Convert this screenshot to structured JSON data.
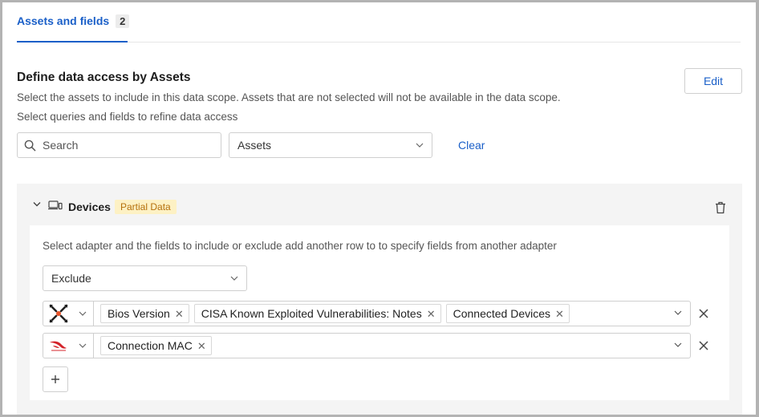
{
  "tabs": [
    {
      "label": "Assets and fields",
      "count": "2"
    }
  ],
  "section": {
    "title": "Define data access by Assets",
    "description": "Select the assets to include in this data scope. Assets that are not selected will not be available in the data scope.",
    "subtitle": "Select queries and fields to refine data access",
    "edit_label": "Edit"
  },
  "filters": {
    "search_placeholder": "Search",
    "assets_value": "Assets",
    "clear_label": "Clear"
  },
  "devices_panel": {
    "label": "Devices",
    "badge": "Partial Data",
    "description": "Select adapter and the fields to include or exclude add another row to to specify fields from another adapter",
    "mode_value": "Exclude",
    "rows": [
      {
        "adapter_icon": "crossed-arrows-adapter-icon",
        "fields": [
          "Bios Version",
          "CISA Known Exploited Vulnerabilities: Notes",
          "Connected Devices"
        ]
      },
      {
        "adapter_icon": "falcon-adapter-icon",
        "fields": [
          "Connection MAC"
        ]
      }
    ]
  },
  "colors": {
    "accent": "#1a5fc8",
    "badge_bg": "#fdf1c4",
    "badge_text": "#b5700c",
    "panel_bg": "#f4f4f4"
  }
}
